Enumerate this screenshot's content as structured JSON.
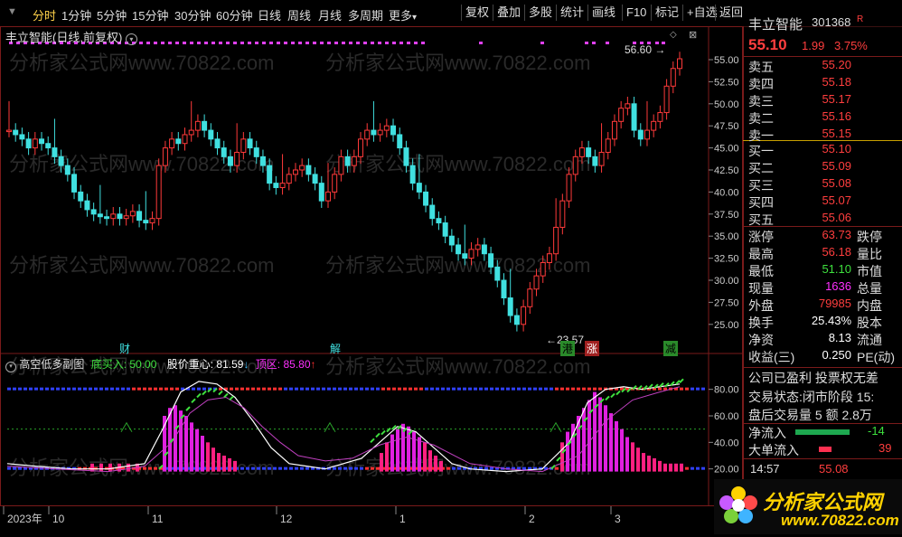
{
  "toolbar": {
    "periods": [
      "分时",
      "1分钟",
      "5分钟",
      "15分钟",
      "30分钟",
      "60分钟",
      "日线",
      "周线",
      "月线",
      "多周期",
      "更多"
    ],
    "right_buttons": [
      "复权",
      "叠加",
      "多股",
      "统计",
      "画线",
      "F10",
      "标记",
      "+自选",
      "返回"
    ]
  },
  "chart": {
    "title": "丰立智能(日线,前复权)",
    "high_label": "56.60",
    "low_label": "23.57",
    "price_axis": [
      "55.00",
      "52.50",
      "50.00",
      "47.50",
      "45.00",
      "42.50",
      "40.00",
      "37.50",
      "35.00",
      "32.50",
      "30.00",
      "27.50",
      "25.00"
    ],
    "event_tags": [
      "财",
      "解",
      "港",
      "涨",
      "减"
    ],
    "watermark": "分析家公式网www.70822.com"
  },
  "indicator": {
    "name": "高空低多副图",
    "buy_label": "底买入: 50.00",
    "gravity_label": "股价重心: 81.59",
    "gravity_arrow": "↓",
    "top_label": "顶区: 85.80",
    "top_arrow": "↑",
    "axis": [
      "80.00",
      "60.00",
      "40.00",
      "20.00"
    ]
  },
  "time_axis": [
    "2023年",
    "10",
    "11",
    "12",
    "1",
    "2",
    "3"
  ],
  "sidebar": {
    "name": "丰立智能",
    "code": "301368",
    "r_mark": "R",
    "price": "55.10",
    "change": "1.99",
    "change_pct": "3.75%",
    "asks": [
      {
        "label": "卖五",
        "price": "55.20"
      },
      {
        "label": "卖四",
        "price": "55.18"
      },
      {
        "label": "卖三",
        "price": "55.17"
      },
      {
        "label": "卖二",
        "price": "55.16"
      },
      {
        "label": "卖一",
        "price": "55.15"
      }
    ],
    "bids": [
      {
        "label": "买一",
        "price": "55.10"
      },
      {
        "label": "买二",
        "price": "55.09"
      },
      {
        "label": "买三",
        "price": "55.08"
      },
      {
        "label": "买四",
        "price": "55.07"
      },
      {
        "label": "买五",
        "price": "55.06"
      }
    ],
    "stats": [
      {
        "label": "涨停",
        "value": "63.73",
        "extra": "跌停",
        "color": "red"
      },
      {
        "label": "最高",
        "value": "56.18",
        "extra": "量比",
        "color": "red"
      },
      {
        "label": "最低",
        "value": "51.10",
        "extra": "市值",
        "color": "green"
      },
      {
        "label": "现量",
        "value": "1636",
        "extra": "总量",
        "color": "mag"
      },
      {
        "label": "外盘",
        "value": "79985",
        "extra": "内盘",
        "color": "red"
      },
      {
        "label": "换手",
        "value": "25.43%",
        "extra": "股本",
        "color": "white"
      },
      {
        "label": "净资",
        "value": "8.13",
        "extra": "流通",
        "color": "white"
      },
      {
        "label": "收益(三)",
        "value": "0.250",
        "extra": "PE(动)",
        "color": "white"
      }
    ],
    "status1": "公司已盈利 投票权无差",
    "status2": "交易状态:闭市阶段 15:",
    "status3": "盘后交易量 5 额 2.8万",
    "net_inflow_label": "净流入",
    "net_inflow_value": "-14",
    "big_inflow_label": "大单流入",
    "big_inflow_value": "39",
    "ticks": [
      {
        "time": "14:57",
        "price": "55.08"
      }
    ]
  },
  "logo": {
    "text": "分析家公式网",
    "url": "www.70822.com"
  }
}
